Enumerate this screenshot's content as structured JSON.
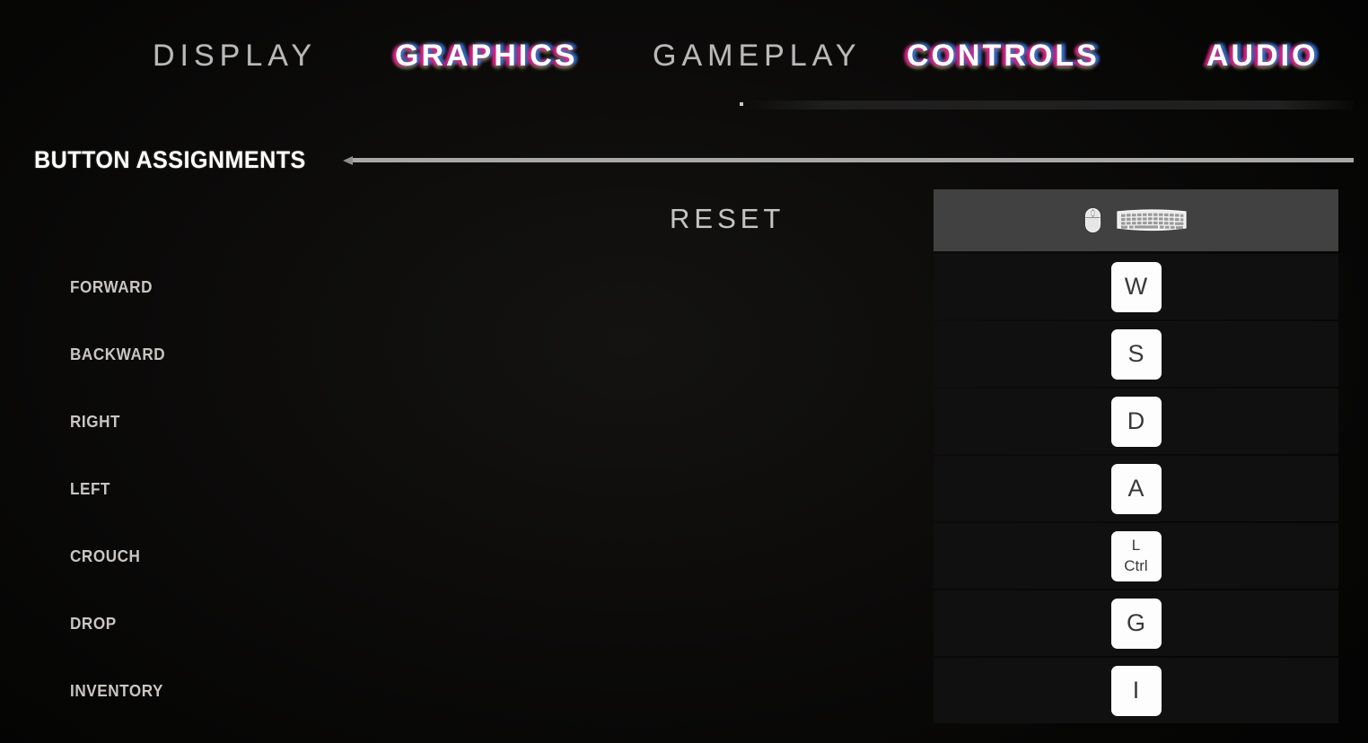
{
  "tabs": [
    {
      "label": "DISPLAY",
      "style": "plain",
      "active": false
    },
    {
      "label": "GRAPHICS",
      "style": "glitch",
      "active": true
    },
    {
      "label": "GAMEPLAY",
      "style": "plain",
      "active": false
    },
    {
      "label": "CONTROLS",
      "style": "glitch",
      "active": true
    },
    {
      "label": "AUDIO",
      "style": "glitch",
      "active": true
    }
  ],
  "section": {
    "title": "BUTTON ASSIGNMENTS"
  },
  "reset": {
    "label": "RESET"
  },
  "bindings": {
    "header": {
      "mouse_icon": "mouse-icon",
      "keyboard_icon": "keyboard-icon"
    },
    "rows": [
      {
        "action": "FORWARD",
        "key_line1": "W",
        "key_line2": ""
      },
      {
        "action": "BACKWARD",
        "key_line1": "S",
        "key_line2": ""
      },
      {
        "action": "RIGHT",
        "key_line1": "D",
        "key_line2": ""
      },
      {
        "action": "LEFT",
        "key_line1": "A",
        "key_line2": ""
      },
      {
        "action": "CROUCH",
        "key_line1": "L",
        "key_line2": "Ctrl"
      },
      {
        "action": "DROP",
        "key_line1": "G",
        "key_line2": ""
      },
      {
        "action": "INVENTORY",
        "key_line1": "I",
        "key_line2": ""
      }
    ]
  },
  "colors": {
    "background": "#0a0a09",
    "header_bar": "#414141",
    "row": "#101010",
    "keycap_bg": "#fdfdfd",
    "keycap_text": "#3a3a3a",
    "label_text": "#c9c6c2",
    "title_text": "#ffffff",
    "tab_inactive": "#b9b9b9",
    "glitch_magenta": "#e9198c",
    "glitch_blue": "#2878e6",
    "glitch_green": "#50c83c",
    "rule": "#a8a8a8"
  }
}
